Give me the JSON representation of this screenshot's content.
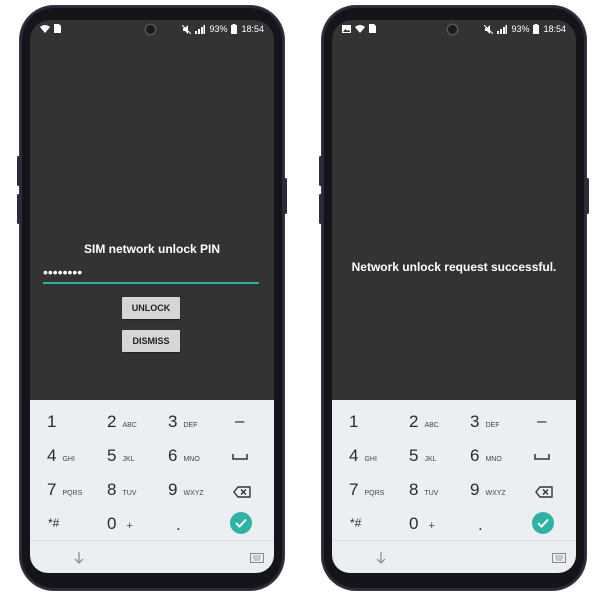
{
  "left_phone": {
    "status": {
      "battery": "93%",
      "time": "18:54",
      "left_icons": [
        "wifi-icon",
        "sim-icon"
      ],
      "right_icons": [
        "mute-icon",
        "signal-icon",
        "battery-icon"
      ]
    },
    "dialog": {
      "title": "SIM network unlock PIN",
      "pin_value": "••••••••",
      "unlock_label": "UNLOCK",
      "dismiss_label": "DISMISS"
    }
  },
  "right_phone": {
    "status": {
      "battery": "93%",
      "time": "18:54",
      "left_icons": [
        "image-icon",
        "wifi-icon",
        "sim-icon"
      ],
      "right_icons": [
        "mute-icon",
        "signal-icon",
        "battery-icon"
      ]
    },
    "message": "Network unlock request successful."
  },
  "keypad": {
    "keys": [
      {
        "num": "1",
        "letters": ""
      },
      {
        "num": "2",
        "letters": "ABC"
      },
      {
        "num": "3",
        "letters": "DEF"
      },
      {
        "num": "–",
        "letters": ""
      },
      {
        "num": "4",
        "letters": "GHI"
      },
      {
        "num": "5",
        "letters": "JKL"
      },
      {
        "num": "6",
        "letters": "MNO"
      },
      {
        "num": "space",
        "letters": ""
      },
      {
        "num": "7",
        "letters": "PQRS"
      },
      {
        "num": "8",
        "letters": "TUV"
      },
      {
        "num": "9",
        "letters": "WXYZ"
      },
      {
        "num": "backspace",
        "letters": ""
      },
      {
        "num": "*#",
        "letters": ""
      },
      {
        "num": "0",
        "letters": "+"
      },
      {
        "num": ".",
        "letters": ""
      },
      {
        "num": "done",
        "letters": ""
      }
    ]
  },
  "colors": {
    "screen": "#333333",
    "accent": "#2bb3a3",
    "keypad_bg": "#eceff1",
    "button_bg": "#d6d6d6"
  },
  "icons": {
    "nav_back": "down-arrow-icon",
    "nav_keyboard": "keyboard-icon"
  }
}
